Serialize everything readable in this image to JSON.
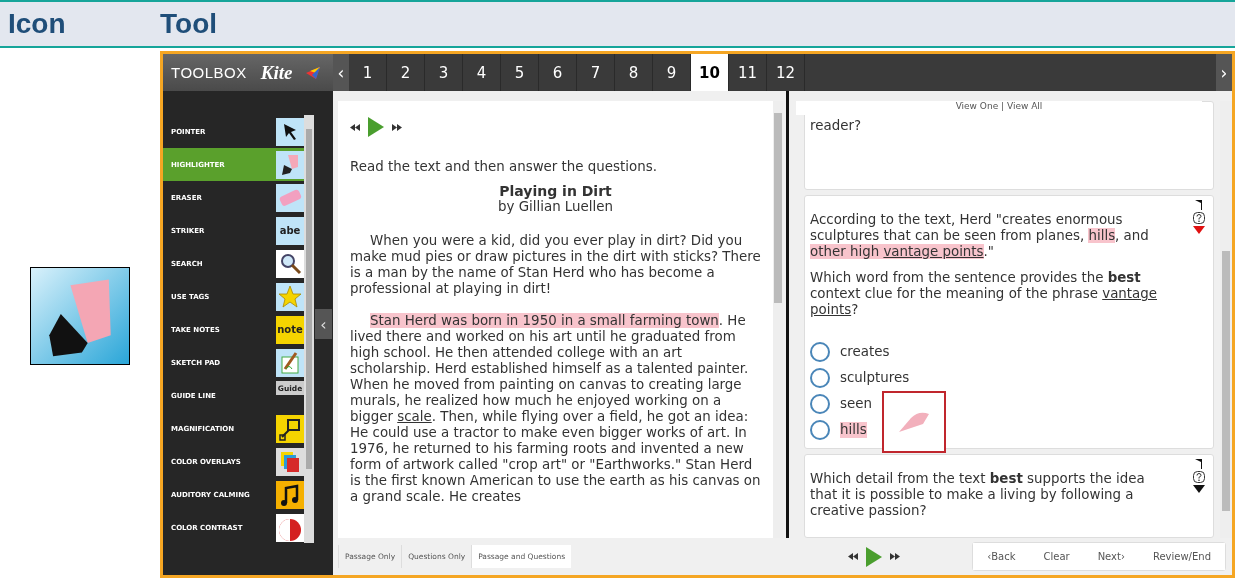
{
  "header": {
    "columns": [
      "Icon",
      "Tool"
    ]
  },
  "toolbox": {
    "title": "TOOLBOX",
    "logo": "Kite",
    "collapse": "‹",
    "items": [
      {
        "label": "POINTER",
        "selected": false
      },
      {
        "label": "HIGHLIGHTER",
        "selected": true
      },
      {
        "label": "ERASER",
        "selected": false
      },
      {
        "label": "STRIKER",
        "selected": false,
        "tile_text": "abe"
      },
      {
        "label": "SEARCH",
        "selected": false
      },
      {
        "label": "USE TAGS",
        "selected": false
      },
      {
        "label": "TAKE NOTES",
        "selected": false,
        "tile_text": "note"
      },
      {
        "label": "SKETCH PAD",
        "selected": false
      },
      {
        "label": "GUIDE LINE",
        "selected": false,
        "tile_text": "Guide"
      },
      {
        "label": "MAGNIFICATION",
        "selected": false
      },
      {
        "label": "COLOR OVERLAYS",
        "selected": false
      },
      {
        "label": "AUDITORY CALMING",
        "selected": false
      },
      {
        "label": "COLOR CONTRAST",
        "selected": false
      }
    ]
  },
  "tabs": {
    "prev": "‹",
    "next": "›",
    "items": [
      {
        "label": "1",
        "selected": false
      },
      {
        "label": "2",
        "selected": false
      },
      {
        "label": "3",
        "selected": false
      },
      {
        "label": "4",
        "selected": false
      },
      {
        "label": "5",
        "selected": false
      },
      {
        "label": "6",
        "selected": false
      },
      {
        "label": "7",
        "selected": false
      },
      {
        "label": "8",
        "selected": false
      },
      {
        "label": "9",
        "selected": false
      },
      {
        "label": "10",
        "selected": true
      },
      {
        "label": "11",
        "selected": false
      },
      {
        "label": "12",
        "selected": false
      }
    ]
  },
  "passage": {
    "instruction": "Read the text and then answer the questions.",
    "title": "Playing in Dirt",
    "author": "by Gillian Luellen",
    "paragraphs": [
      [
        {
          "kind": "plain",
          "text": "When you were a kid, did you ever play in dirt? Did you make mud pies or draw pictures in the dirt with sticks? There is a man by the name of Stan Herd who has become a professional at playing in dirt!"
        }
      ],
      [
        {
          "kind": "highlight",
          "text": "Stan Herd was born in 1950 in a small farming town"
        },
        {
          "kind": "plain",
          "text": ". He lived there and worked on his art until he graduated from high school. He then attended college with an art scholarship. Herd established himself as a talented painter. When he moved from painting on canvas to creating large murals, he realized how much he enjoyed working on a bigger "
        },
        {
          "kind": "underline",
          "text": "scale"
        },
        {
          "kind": "plain",
          "text": ". Then, while flying over a field, he got an idea: He could use a tractor to make even bigger works of art. In 1976, he returned to his farming roots and invented a new form of artwork called \"crop art\" or \"Earthworks.\" Stan Herd is the first known American to use the earth as his canvas on a grand scale. He creates"
        }
      ]
    ]
  },
  "view_toggle": {
    "view_one": "View One",
    "separator": "|",
    "view_all": "View All"
  },
  "questions": [
    {
      "paragraphs": [
        [
          {
            "kind": "plain",
            "text": "reader?"
          }
        ]
      ]
    },
    {
      "current": true,
      "paragraphs": [
        [
          {
            "kind": "plain",
            "text": "According to the text, Herd \"creates enormous sculptures that can be seen from planes, "
          },
          {
            "kind": "highlight",
            "text": "hills"
          },
          {
            "kind": "plain",
            "text": ", and "
          },
          {
            "kind": "highlight",
            "text": "other high "
          },
          {
            "kind": "highlight-underline",
            "text": "vantage points"
          },
          {
            "kind": "plain",
            "text": ".\""
          }
        ],
        [
          {
            "kind": "plain",
            "text": "Which word from the sentence provides the "
          },
          {
            "kind": "bold",
            "text": "best"
          },
          {
            "kind": "plain",
            "text": " context clue for the meaning of the phrase "
          },
          {
            "kind": "underline",
            "text": "vantage points"
          },
          {
            "kind": "plain",
            "text": "?"
          }
        ]
      ],
      "options": [
        {
          "label": "creates",
          "selected": false,
          "highlighted": false
        },
        {
          "label": "sculptures",
          "selected": false,
          "highlighted": false
        },
        {
          "label": "seen",
          "selected": false,
          "highlighted": false
        },
        {
          "label": "hills",
          "selected": false,
          "highlighted": true
        }
      ]
    },
    {
      "current": false,
      "paragraphs": [
        [
          {
            "kind": "plain",
            "text": "Which detail from the text "
          },
          {
            "kind": "bold",
            "text": "best"
          },
          {
            "kind": "plain",
            "text": " supports the idea that it is possible to make a living by following a creative passion?"
          }
        ]
      ]
    }
  ],
  "layout_tabs": [
    {
      "label": "Passage Only",
      "selected": false
    },
    {
      "label": "Questions Only",
      "selected": false
    },
    {
      "label": "Passage and Questions",
      "selected": true
    }
  ],
  "nav_buttons": [
    "‹Back",
    "Clear",
    "Next›",
    "Review/End"
  ]
}
